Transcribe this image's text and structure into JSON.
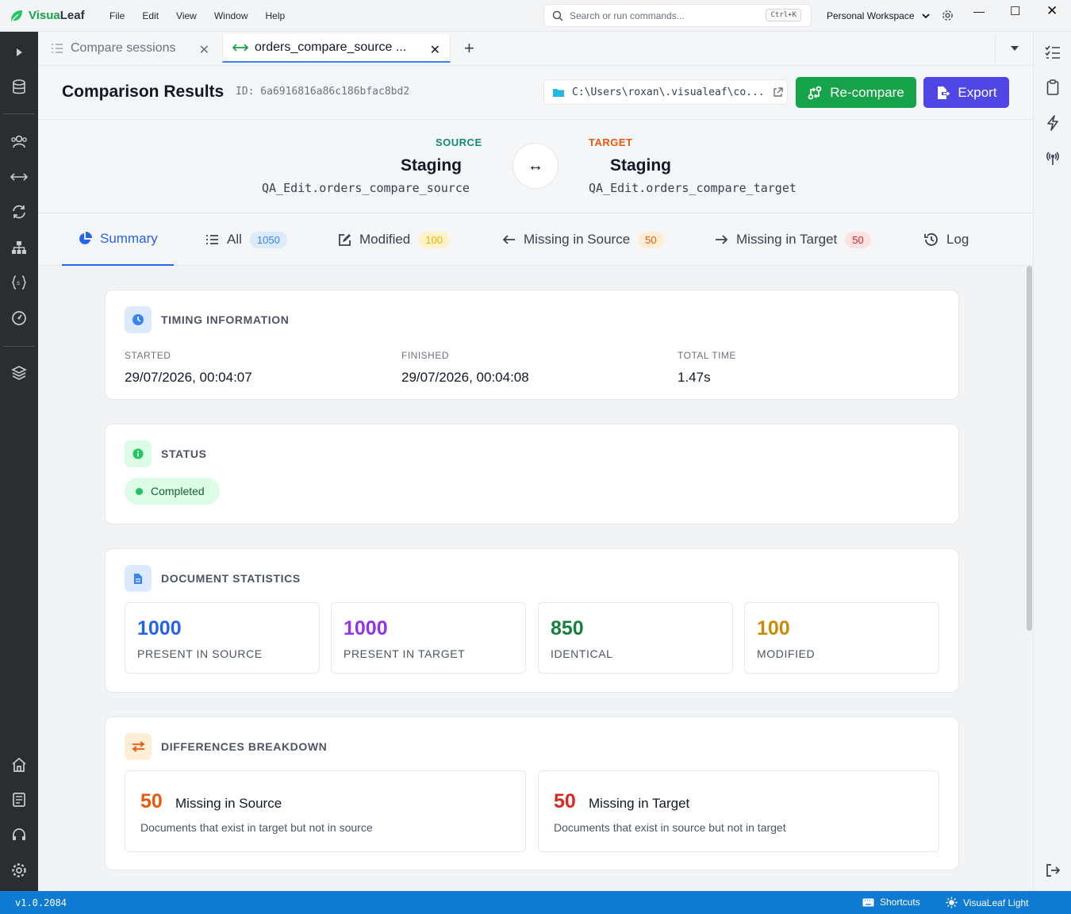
{
  "app": {
    "name_prefix": "Visua",
    "name_suffix": "Leaf"
  },
  "menu": [
    "File",
    "Edit",
    "View",
    "Window",
    "Help"
  ],
  "search": {
    "placeholder": "Search or run commands...",
    "shortcut": "Ctrl+K"
  },
  "workspace": {
    "label": "Personal Workspace"
  },
  "tabs": [
    {
      "label": "Compare sessions",
      "active": false
    },
    {
      "label": "orders_compare_source ...",
      "active": true
    }
  ],
  "header": {
    "title": "Comparison Results",
    "id": "ID: 6a6916816a86c186bfac8bd2",
    "path": "C:\\Users\\roxan\\.visualeaf\\co...",
    "recompare_label": "Re-compare",
    "export_label": "Export"
  },
  "source": {
    "label": "SOURCE",
    "name": "Staging",
    "collection": "QA_Edit.orders_compare_source"
  },
  "target": {
    "label": "TARGET",
    "name": "Staging",
    "collection": "QA_Edit.orders_compare_target"
  },
  "nav": [
    {
      "label": "Summary"
    },
    {
      "label": "All",
      "badge": "1050"
    },
    {
      "label": "Modified",
      "badge": "100"
    },
    {
      "label": "Missing in Source",
      "badge": "50"
    },
    {
      "label": "Missing in Target",
      "badge": "50"
    },
    {
      "label": "Log"
    }
  ],
  "timing": {
    "title": "TIMING INFORMATION",
    "started_label": "STARTED",
    "started": "29/07/2026, 00:04:07",
    "finished_label": "FINISHED",
    "finished": "29/07/2026, 00:04:08",
    "total_label": "TOTAL TIME",
    "total": "1.47s"
  },
  "status": {
    "title": "STATUS",
    "value": "Completed"
  },
  "stats": {
    "title": "DOCUMENT STATISTICS",
    "items": [
      {
        "value": "1000",
        "label": "PRESENT IN SOURCE",
        "color": "#2563eb"
      },
      {
        "value": "1000",
        "label": "PRESENT IN TARGET",
        "color": "#9333ea"
      },
      {
        "value": "850",
        "label": "IDENTICAL",
        "color": "#15803d"
      },
      {
        "value": "100",
        "label": "MODIFIED",
        "color": "#ca8a04"
      }
    ]
  },
  "differences": {
    "title": "DIFFERENCES BREAKDOWN",
    "items": [
      {
        "value": "50",
        "title": "Missing in Source",
        "desc": "Documents that exist in target but not in source",
        "color": "#ea580c"
      },
      {
        "value": "50",
        "title": "Missing in Target",
        "desc": "Documents that exist in source but not in target",
        "color": "#dc2626"
      }
    ]
  },
  "statusbar": {
    "version": "v1.0.2084",
    "shortcuts": "Shortcuts",
    "theme": "VisuaLeaf Light"
  },
  "colors": {
    "accent": "#2563eb",
    "success": "#16a34a",
    "export": "#4f46e5",
    "statusbar": "#0e7ad1"
  }
}
